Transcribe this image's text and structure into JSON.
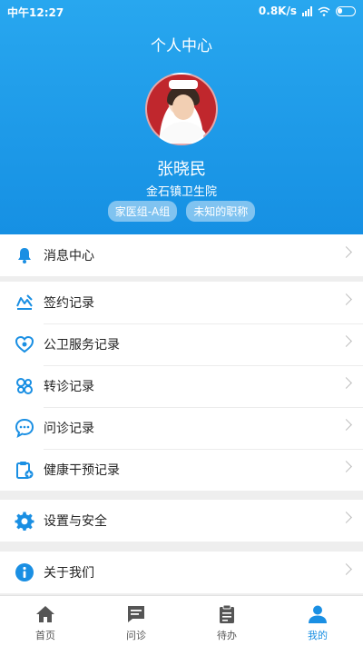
{
  "status": {
    "time": "中午12:27",
    "speed": "0.8K/s"
  },
  "header": {
    "title": "个人中心"
  },
  "profile": {
    "name": "张晓民",
    "hospital": "金石镇卫生院",
    "tags": [
      "家医组-A组",
      "未知的职称"
    ]
  },
  "groups": [
    [
      {
        "label": "消息中心",
        "icon": "bell-icon"
      }
    ],
    [
      {
        "label": "签约记录",
        "icon": "sign-icon"
      },
      {
        "label": "公卫服务记录",
        "icon": "heart-icon"
      },
      {
        "label": "转诊记录",
        "icon": "referral-icon"
      },
      {
        "label": "问诊记录",
        "icon": "chat-icon"
      },
      {
        "label": "健康干预记录",
        "icon": "clipboard-plus-icon"
      }
    ],
    [
      {
        "label": "设置与安全",
        "icon": "gear-icon"
      }
    ],
    [
      {
        "label": "关于我们",
        "icon": "info-icon"
      }
    ]
  ],
  "tabs": [
    {
      "label": "首页",
      "icon": "home-icon"
    },
    {
      "label": "问诊",
      "icon": "message-icon"
    },
    {
      "label": "待办",
      "icon": "clipboard-icon"
    },
    {
      "label": "我的",
      "icon": "person-icon",
      "active": true
    }
  ],
  "colors": {
    "accent": "#1a8fe3",
    "header_top": "#28a7ef",
    "header_bottom": "#1690e3"
  }
}
